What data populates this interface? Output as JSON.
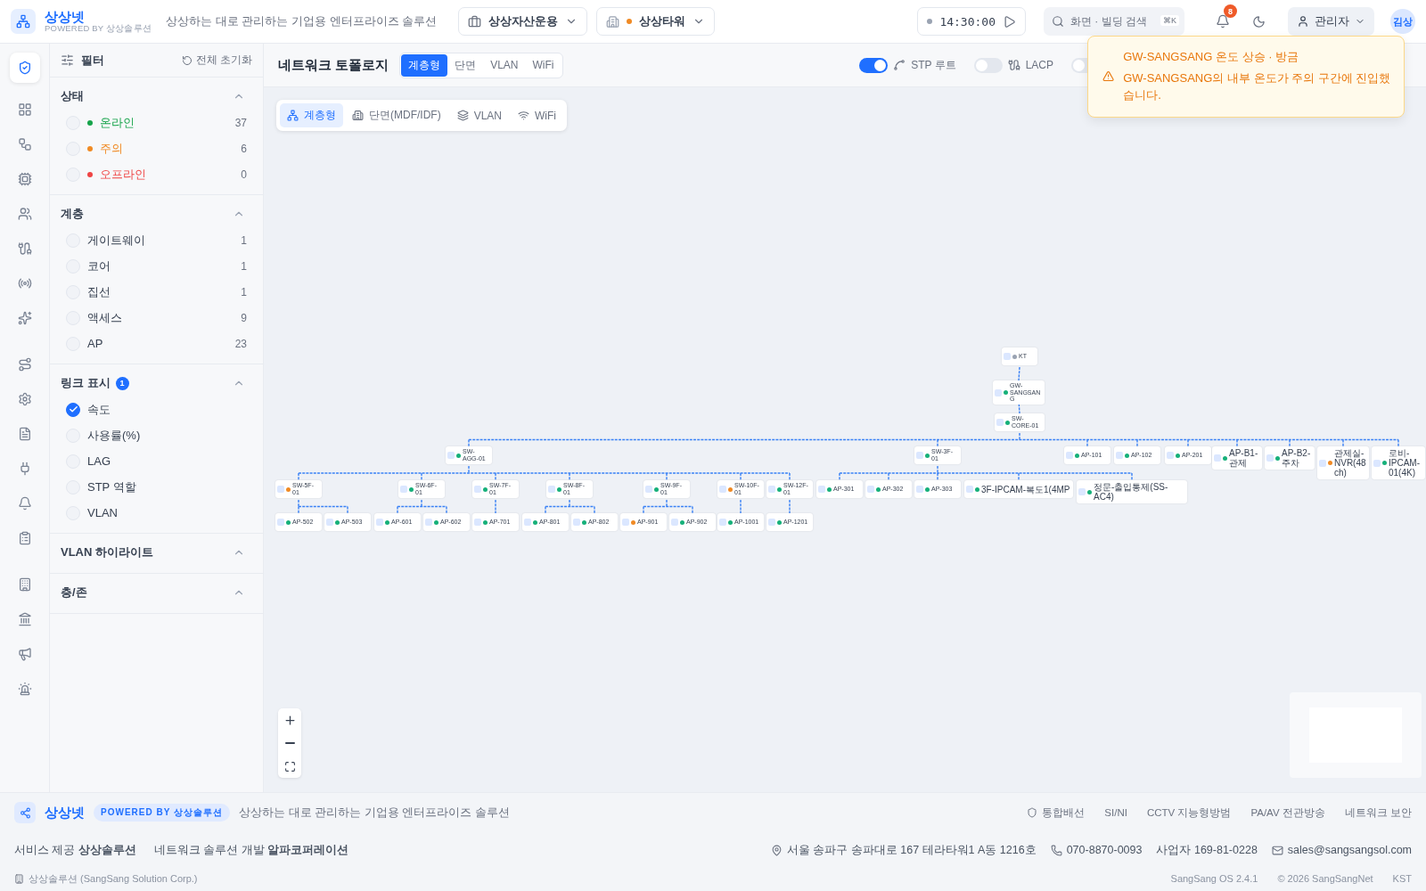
{
  "header": {
    "brand": "상상넷",
    "powered": "POWERED BY 상상솔루션",
    "tagline": "상상하는 대로 관리하는 기업용 엔터프라이즈 솔루션",
    "company_select": "상상자산운용",
    "building_select": "상상타워",
    "clock": "14:30:00",
    "search": {
      "placeholder": "화면 · 빌딩 검색",
      "shortcut": "⌘K"
    },
    "notifications": "8",
    "user": "관리자",
    "avatar": "김상"
  },
  "nav_rail": [
    {
      "selected": true
    },
    {
      "selected": false
    },
    {
      "selected": false
    },
    {
      "selected": false
    },
    {
      "selected": false
    },
    {
      "selected": false
    },
    {
      "selected": false
    },
    {
      "selected": false
    },
    {
      "selected": false
    },
    {
      "selected": false
    },
    {
      "selected": false
    },
    {
      "selected": false
    },
    {
      "selected": false
    },
    {
      "selected": false
    },
    {
      "selected": false
    },
    {
      "selected": false
    },
    {
      "selected": false
    },
    {
      "selected": false
    }
  ],
  "filter": {
    "title": "필터",
    "reset": "전체 초기화",
    "sections": [
      {
        "title": "상태",
        "items": [
          {
            "label": "온라인",
            "color": "#16a34a",
            "count": "37",
            "checked": false
          },
          {
            "label": "주의",
            "color": "#f08a24",
            "count": "6",
            "checked": false
          },
          {
            "label": "오프라인",
            "color": "#ef4444",
            "count": "0",
            "checked": false
          }
        ]
      },
      {
        "title": "계층",
        "items": [
          {
            "label": "게이트웨이",
            "count": "1",
            "checked": false
          },
          {
            "label": "코어",
            "count": "1",
            "checked": false
          },
          {
            "label": "집선",
            "count": "1",
            "checked": false
          },
          {
            "label": "액세스",
            "count": "9",
            "checked": false
          },
          {
            "label": "AP",
            "count": "23",
            "checked": false
          }
        ]
      },
      {
        "title": "링크 표시",
        "badge": "1",
        "items": [
          {
            "label": "속도",
            "checked": true
          },
          {
            "label": "사용률(%)",
            "checked": false
          },
          {
            "label": "LAG",
            "checked": false
          },
          {
            "label": "STP 역할",
            "checked": false
          },
          {
            "label": "VLAN",
            "checked": false
          }
        ]
      },
      {
        "title": "VLAN 하이라이트"
      },
      {
        "title": "층/존"
      }
    ]
  },
  "toolbar": {
    "title": "네트워크 토폴로지",
    "tabs": [
      {
        "label": "계층형",
        "selected": true
      },
      {
        "label": "단면",
        "selected": false
      },
      {
        "label": "VLAN",
        "selected": false
      },
      {
        "label": "WiFi",
        "selected": false
      }
    ],
    "toggles": [
      {
        "label": "STP 루트",
        "on": true
      },
      {
        "label": "LACP",
        "on": false
      },
      {
        "on": false
      }
    ]
  },
  "view_tabs": [
    {
      "label": "계층형",
      "selected": true
    },
    {
      "label": "단면(MDF/IDF)",
      "selected": false
    },
    {
      "label": "VLAN",
      "selected": false
    },
    {
      "label": "WiFi",
      "selected": false
    }
  ],
  "topology": {
    "nodes": [
      {
        "name": "KT",
        "color": "#9aa3b2",
        "children": [
          {
            "name": "GW-SANGSANG",
            "color": "#16b07a",
            "children": [
              {
                "name": "SW-CORE-01",
                "color": "#16b07a",
                "children": [
                  {
                    "name": "SW-AGG-01",
                    "color": "#16b07a",
                    "children": [
                      {
                        "name": "SW-5F-01",
                        "color": "#f08a24",
                        "children": [
                          {
                            "name": "AP-502",
                            "color": "#16b07a"
                          },
                          {
                            "name": "AP-503",
                            "color": "#16b07a"
                          }
                        ]
                      },
                      {
                        "name": "SW-6F-01",
                        "color": "#16b07a",
                        "children": [
                          {
                            "name": "AP-601",
                            "color": "#16b07a"
                          },
                          {
                            "name": "AP-602",
                            "color": "#16b07a"
                          }
                        ]
                      },
                      {
                        "name": "SW-7F-01",
                        "color": "#16b07a",
                        "children": [
                          {
                            "name": "AP-701",
                            "color": "#16b07a"
                          }
                        ]
                      },
                      {
                        "name": "SW-8F-01",
                        "color": "#16b07a",
                        "children": [
                          {
                            "name": "AP-801",
                            "color": "#16b07a"
                          },
                          {
                            "name": "AP-802",
                            "color": "#16b07a"
                          }
                        ]
                      },
                      {
                        "name": "SW-9F-01",
                        "color": "#16b07a",
                        "children": [
                          {
                            "name": "AP-901",
                            "color": "#f08a24"
                          },
                          {
                            "name": "AP-902",
                            "color": "#16b07a"
                          }
                        ]
                      },
                      {
                        "name": "SW-10F-01",
                        "color": "#f08a24",
                        "children": [
                          {
                            "name": "AP-1001",
                            "color": "#16b07a"
                          }
                        ]
                      },
                      {
                        "name": "SW-12F-01",
                        "color": "#16b07a",
                        "children": [
                          {
                            "name": "AP-1201",
                            "color": "#16b07a"
                          }
                        ]
                      }
                    ]
                  },
                  {
                    "name": "SW-3F-01",
                    "color": "#16b07a",
                    "children": [
                      {
                        "name": "AP-301",
                        "color": "#16b07a"
                      },
                      {
                        "name": "AP-302",
                        "color": "#16b07a"
                      },
                      {
                        "name": "AP-303",
                        "color": "#16b07a"
                      },
                      {
                        "name": "3F-IPCAM-복도1(4MP",
                        "color": "#16b07a"
                      },
                      {
                        "name": "정문-출입통제(SS-AC4)",
                        "color": "#16b07a"
                      }
                    ]
                  },
                  {
                    "name": "AP-101",
                    "color": "#16b07a"
                  },
                  {
                    "name": "AP-102",
                    "color": "#16b07a"
                  },
                  {
                    "name": "AP-201",
                    "color": "#16b07a"
                  },
                  {
                    "name": "AP-B1-관제",
                    "color": "#16b07a"
                  },
                  {
                    "name": "AP-B2-주차",
                    "color": "#16b07a"
                  },
                  {
                    "name": "관제실-NVR(48ch)",
                    "color": "#f08a24"
                  },
                  {
                    "name": "로비-IPCAM-01(4K)",
                    "color": "#16b07a"
                  }
                ]
              }
            ]
          }
        ]
      }
    ]
  },
  "toast": {
    "title": "GW-SANGSANG 온도 상승 · 방금",
    "message": "GW-SANGSANG의 내부 온도가 주의 구간에 진입했습니다."
  },
  "footer": {
    "brand": "상상넷",
    "powered": "POWERED BY 상상솔루션",
    "tagline": "상상하는 대로 관리하는 기업용 엔터프라이즈 솔루션",
    "links": [
      "통합배선",
      "SI/NI",
      "CCTV 지능형방범",
      "PA/AV 전관방송",
      "네트워크 보안"
    ],
    "credits": [
      "서비스 제공 **상상솔루션**",
      "네트워크 솔루션 개발 **알파코퍼레이션**"
    ],
    "address": "서울 송파구 송파대로 167 테라타워1 A동 1216호",
    "phone": "070-8870-0093",
    "business": "사업자 169-81-0228",
    "email": "sales@sangsangsol.com",
    "company": "상상솔루션 (SangSang Solution Corp.)",
    "version": "SangSang OS 2.4.1",
    "copyright": "© 2026 SangSangNet",
    "timezone": "KST"
  }
}
